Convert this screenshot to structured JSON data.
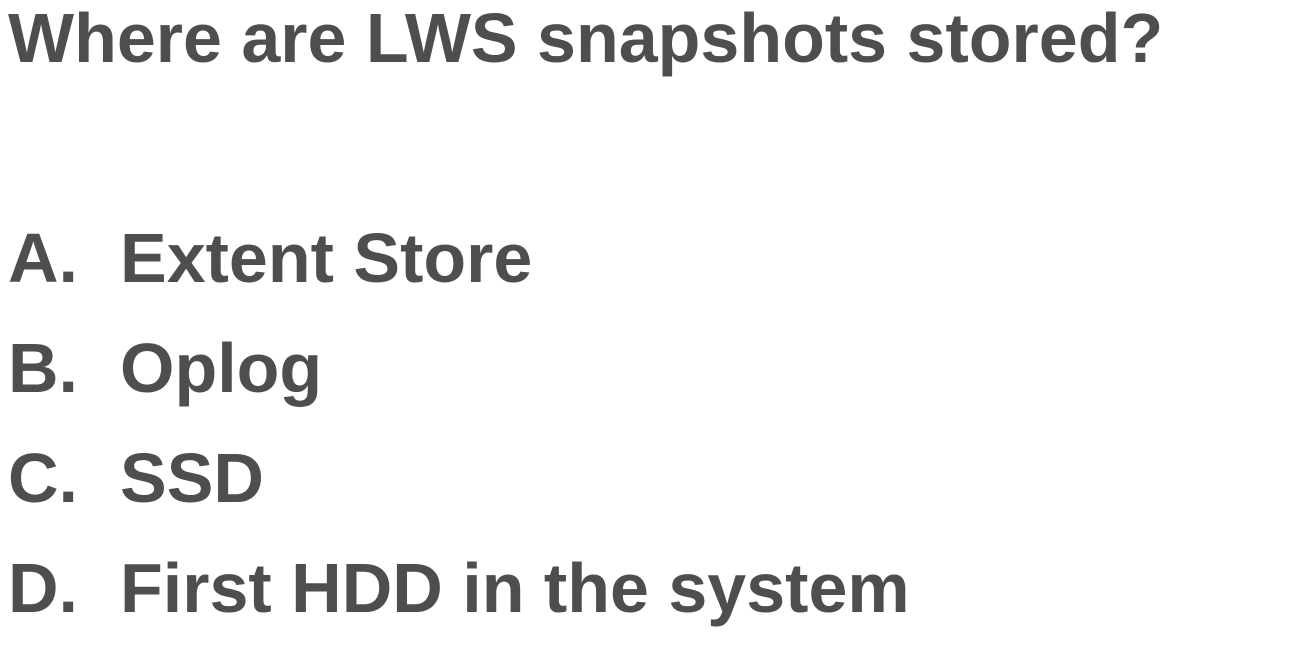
{
  "question": "Where are LWS snapshots stored?",
  "options": [
    {
      "letter": "A.",
      "text": "Extent Store"
    },
    {
      "letter": "B.",
      "text": "Oplog"
    },
    {
      "letter": "C.",
      "text": "SSD"
    },
    {
      "letter": "D.",
      "text": "First HDD in the system"
    }
  ]
}
